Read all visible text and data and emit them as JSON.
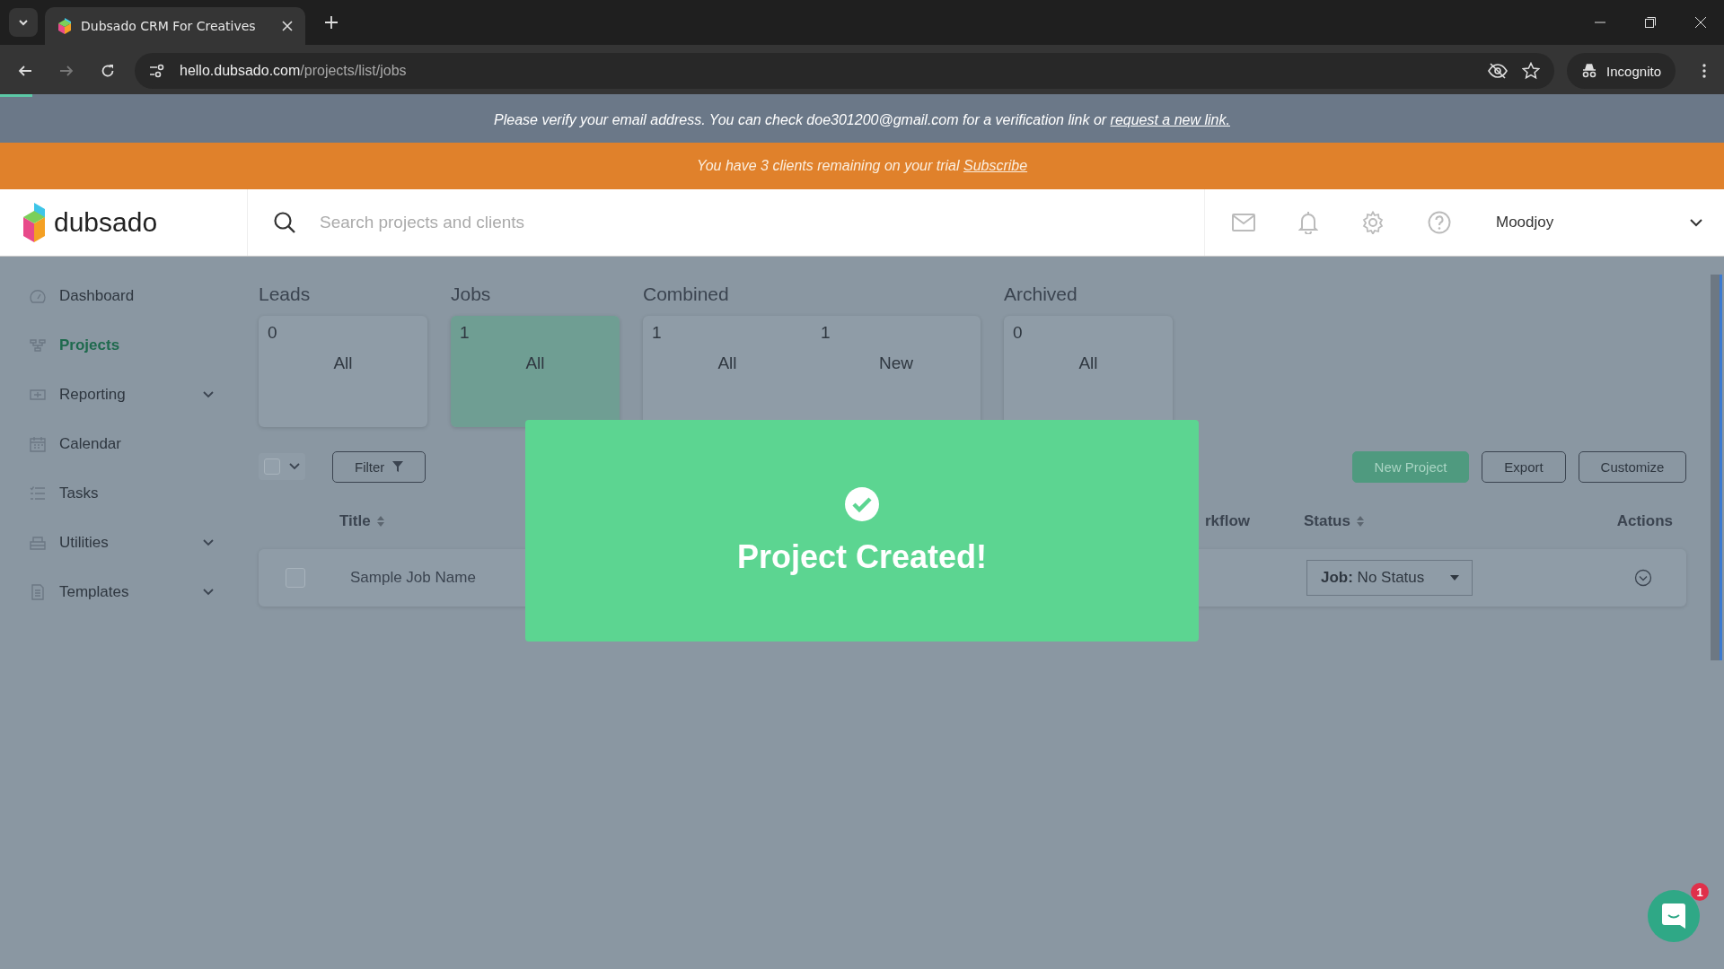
{
  "browser": {
    "tab_title": "Dubsado CRM For Creatives",
    "url_host": "hello.dubsado.com",
    "url_path": "/projects/list/jobs",
    "profile": "Incognito"
  },
  "verify_banner": {
    "text": "Please verify your email address. You can check doe301200@gmail.com for a verification link or",
    "link": "request a new link."
  },
  "trial_banner": {
    "text": "You have 3 clients remaining on your trial",
    "link": "Subscribe"
  },
  "header": {
    "logo": "dubsado",
    "search": {
      "placeholder": "Search projects and clients"
    },
    "user": "Moodjoy"
  },
  "sidebar": {
    "items": [
      {
        "label": "Dashboard",
        "selected": false,
        "expandable": false
      },
      {
        "label": "Projects",
        "selected": true,
        "expandable": false
      },
      {
        "label": "Reporting",
        "selected": false,
        "expandable": true
      },
      {
        "label": "Calendar",
        "selected": false,
        "expandable": false
      },
      {
        "label": "Tasks",
        "selected": false,
        "expandable": false
      },
      {
        "label": "Utilities",
        "selected": false,
        "expandable": true
      },
      {
        "label": "Templates",
        "selected": false,
        "expandable": true
      }
    ]
  },
  "groups": [
    {
      "title": "Leads",
      "cards": [
        {
          "count": "0",
          "label": "All",
          "selected": false
        }
      ]
    },
    {
      "title": "Jobs",
      "cards": [
        {
          "count": "1",
          "label": "All",
          "selected": true
        }
      ]
    },
    {
      "title": "Combined",
      "cards": [
        {
          "count": "1",
          "label": "All",
          "selected": false
        },
        {
          "count": "1",
          "label": "New",
          "selected": false
        }
      ]
    },
    {
      "title": "Archived",
      "cards": [
        {
          "count": "0",
          "label": "All",
          "selected": false
        }
      ]
    }
  ],
  "toolbar": {
    "select_all": {
      "checked": false
    },
    "filter": "Filter",
    "buttons": [
      {
        "label": "New Project",
        "kind": "primary"
      },
      {
        "label": "Export",
        "kind": "outline"
      },
      {
        "label": "Customize",
        "kind": "outline"
      }
    ]
  },
  "table": {
    "columns": [
      {
        "label": "Title",
        "sortable": true
      },
      {
        "label": "rkflow",
        "sortable": false
      },
      {
        "label": "Status",
        "sortable": true
      },
      {
        "label": "Actions",
        "sortable": false
      }
    ],
    "rows": [
      {
        "checked": false,
        "title": "Sample Job Name",
        "status_prefix": "Job:",
        "status": "No Status"
      }
    ]
  },
  "modal": {
    "title": "Project Created!"
  },
  "chat": {
    "badge": "1"
  }
}
